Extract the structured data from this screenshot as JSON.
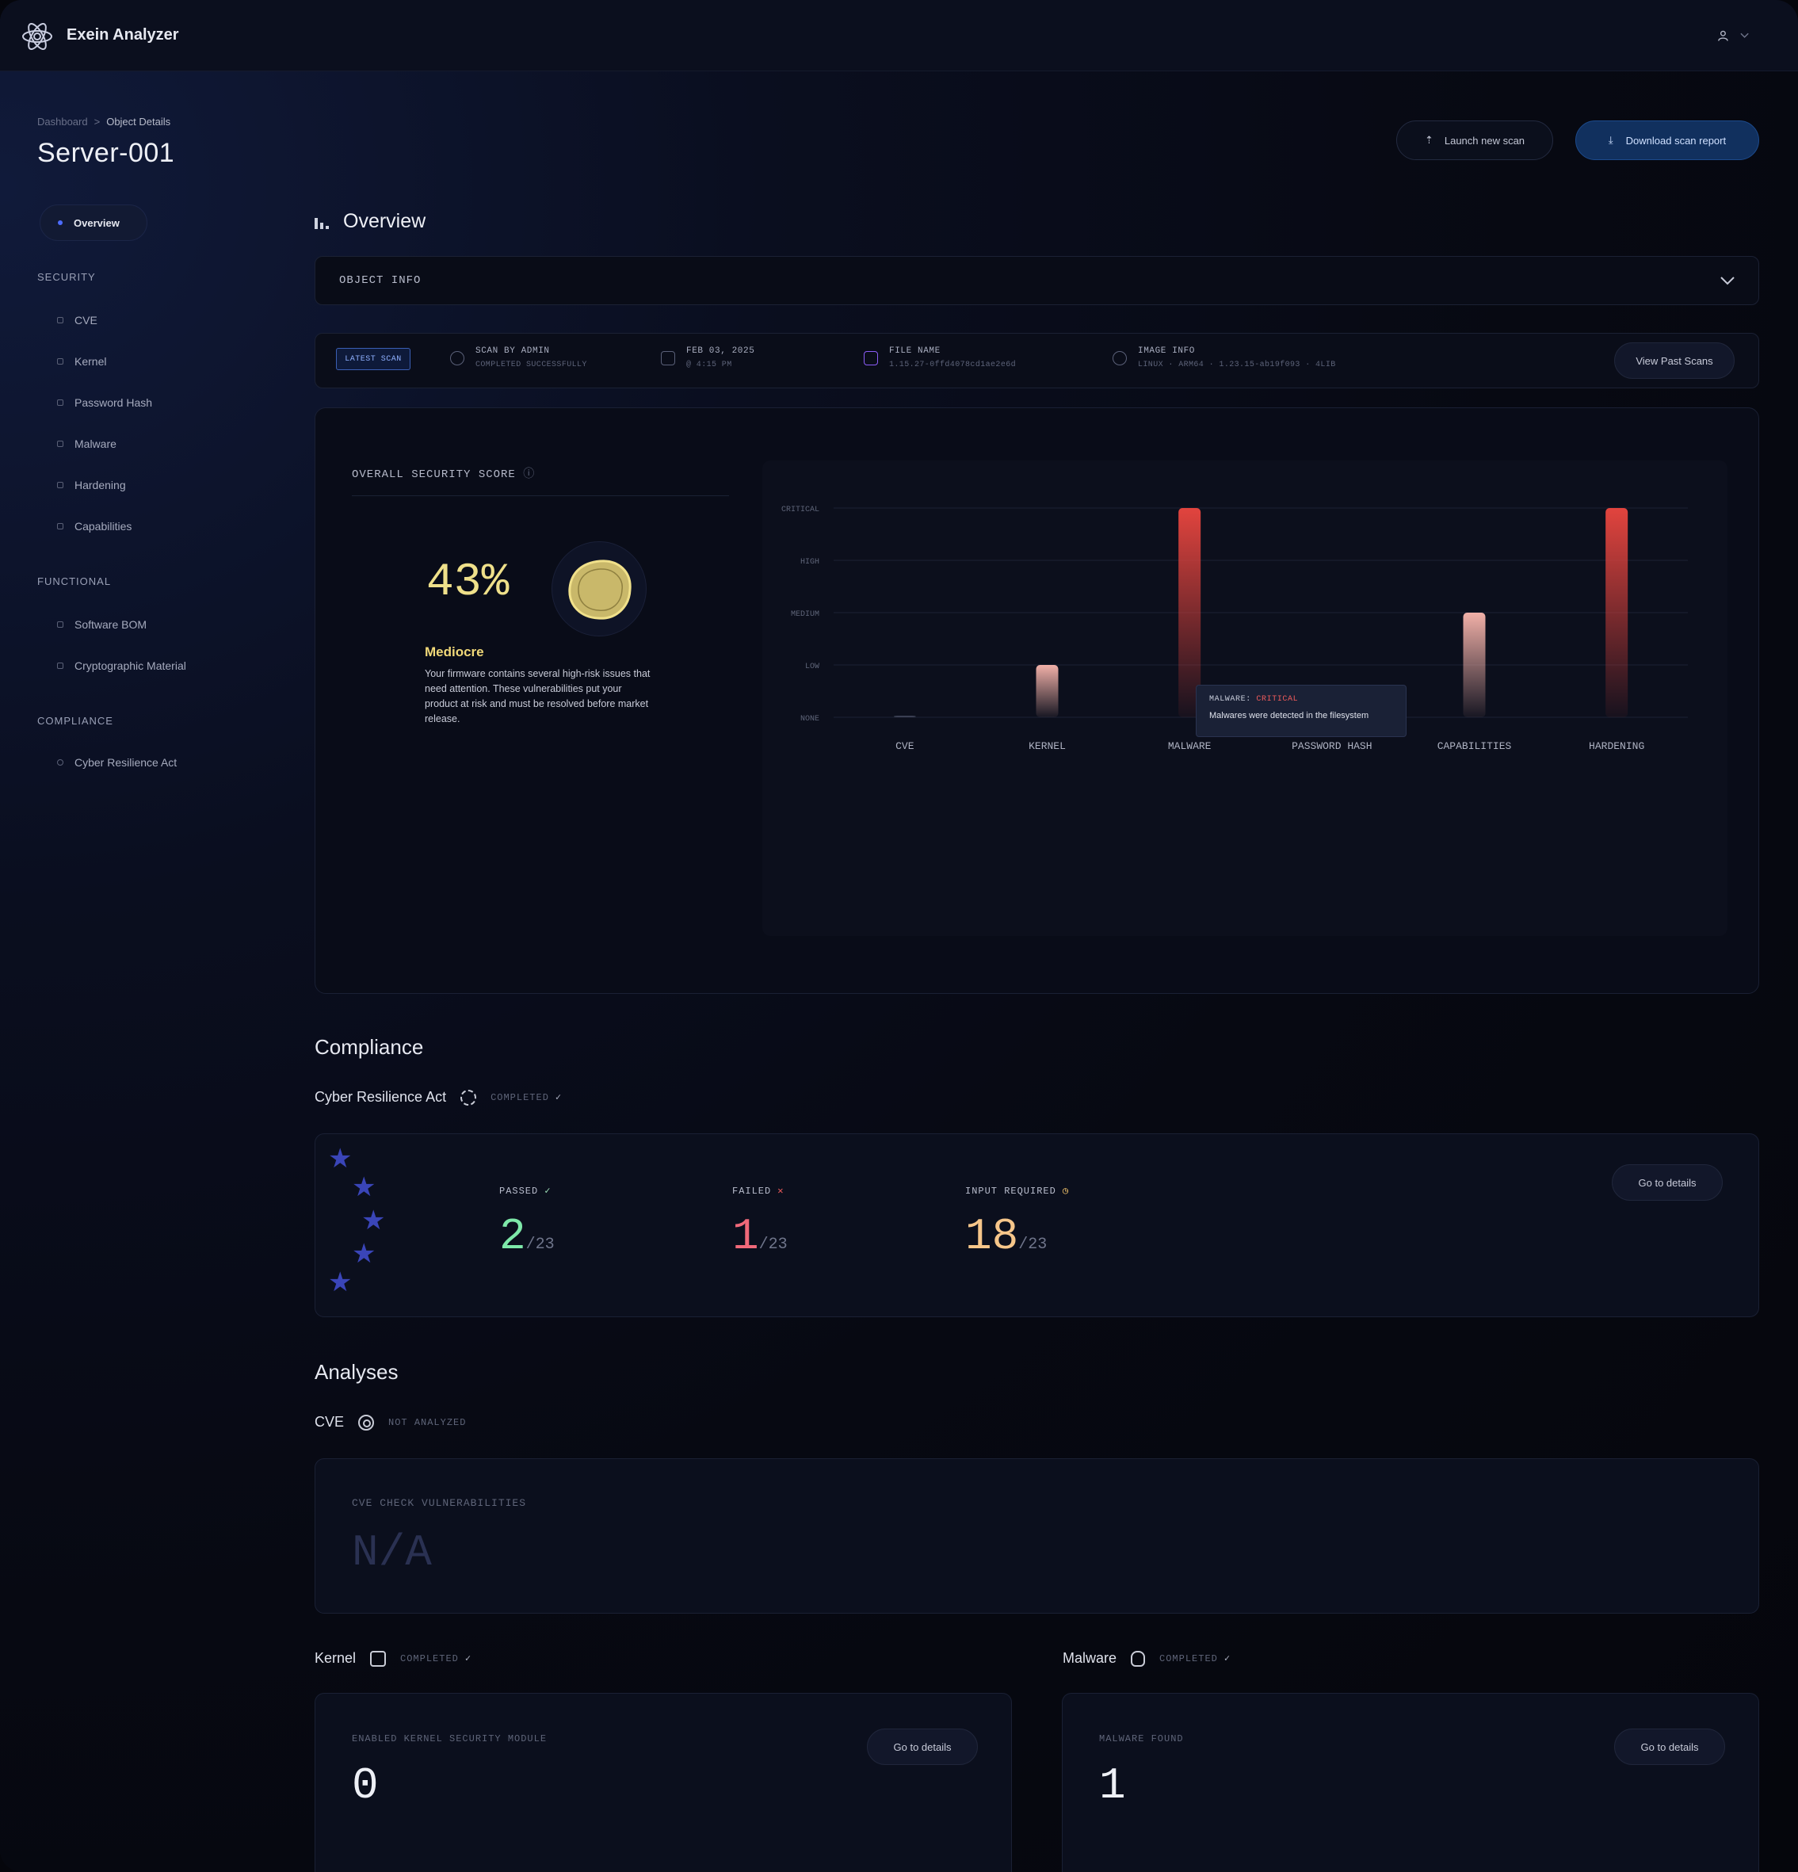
{
  "app": {
    "title": "Exein Analyzer"
  },
  "breadcrumb": {
    "root": "Dashboard",
    "separator": ">",
    "current": "Object Details"
  },
  "object": {
    "title": "Server-001"
  },
  "sidebar": {
    "active": "Overview",
    "sections": [
      {
        "title": "SECURITY",
        "items": [
          "CVE",
          "Kernel",
          "Password Hash",
          "Malware",
          "Hardening",
          "Capabilities"
        ]
      },
      {
        "title": "FUNCTIONAL",
        "items": [
          "Software BOM",
          "Cryptographic Material"
        ]
      },
      {
        "title": "COMPLIANCE",
        "items": [
          "Cyber Resilience Act"
        ]
      }
    ]
  },
  "actions": {
    "launch": "Launch new scan",
    "download": "Download scan report"
  },
  "overview": {
    "title": "Overview",
    "accordion_label": "OBJECT INFO"
  },
  "scan": {
    "badge": "LATEST SCAN",
    "by": "SCAN BY ADMIN",
    "by_status": "COMPLETED SUCCESSFULLY",
    "date": "FEB 03, 2025",
    "time": "@ 4:15 PM",
    "file_label": "FILE NAME",
    "file_value": "1.15.27-0ffd4078cd1ae2e6d",
    "image_label": "IMAGE INFO",
    "image_value": "LINUX · ARM64 · 1.23.15-ab19f093 · 4LIB",
    "past_button": "View Past Scans"
  },
  "security": {
    "title": "OVERALL SECURITY SCORE",
    "score": "43%",
    "rating": "Mediocre",
    "description": "Your firmware contains several high-risk issues that need attention. These vulnerabilities put your product at risk and must be resolved before market release."
  },
  "chart_data": {
    "type": "bar",
    "categories": [
      "CVE",
      "KERNEL",
      "MALWARE",
      "PASSWORD HASH",
      "CAPABILITIES",
      "HARDENING"
    ],
    "y_levels": [
      "NONE",
      "LOW",
      "MEDIUM",
      "HIGH",
      "CRITICAL"
    ],
    "values": [
      0,
      1,
      4,
      0,
      2,
      4
    ],
    "ylim": [
      0,
      4
    ],
    "grid": true,
    "tooltip": {
      "category": "MALWARE:",
      "severity": "CRITICAL",
      "text": "Malwares were detected in the filesystem"
    },
    "colors": {
      "critical": "#e2443e",
      "low": "#f1b0a8"
    }
  },
  "compliance": {
    "title": "Compliance",
    "name": "Cyber Resilience Act",
    "status": "COMPLETED",
    "passed_label": "PASSED",
    "passed": "2",
    "failed_label": "FAILED",
    "failed": "1",
    "input_label": "INPUT REQUIRED",
    "input": "18",
    "total": "/23",
    "details_button": "Go to details"
  },
  "analyses": {
    "title": "Analyses",
    "cve": {
      "name": "CVE",
      "status": "NOT ANALYZED",
      "label": "CVE CHECK VULNERABILITIES",
      "value": "N/A"
    },
    "kernel": {
      "name": "Kernel",
      "status": "COMPLETED",
      "label": "ENABLED KERNEL SECURITY MODULE",
      "value": "0",
      "button": "Go to details"
    },
    "malware": {
      "name": "Malware",
      "status": "COMPLETED",
      "label": "MALWARE FOUND",
      "value": "1",
      "button": "Go to details"
    }
  }
}
